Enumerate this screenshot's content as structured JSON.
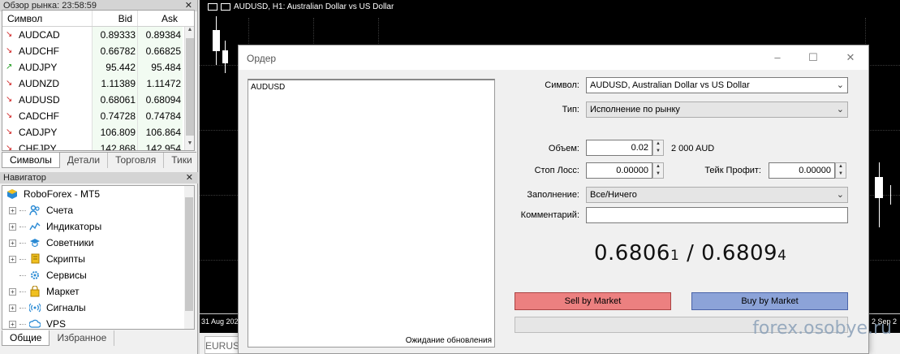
{
  "market_watch": {
    "title": "Обзор рынка: 23:58:59",
    "columns": [
      "Символ",
      "Bid",
      "Ask"
    ],
    "rows": [
      {
        "symbol": "AUDCAD",
        "dir": "down",
        "bid": "0.89333",
        "ask": "0.89384"
      },
      {
        "symbol": "AUDCHF",
        "dir": "down",
        "bid": "0.66782",
        "ask": "0.66825"
      },
      {
        "symbol": "AUDJPY",
        "dir": "up",
        "bid": "95.442",
        "ask": "95.484"
      },
      {
        "symbol": "AUDNZD",
        "dir": "down",
        "bid": "1.11389",
        "ask": "1.11472"
      },
      {
        "symbol": "AUDUSD",
        "dir": "down",
        "bid": "0.68061",
        "ask": "0.68094"
      },
      {
        "symbol": "CADCHF",
        "dir": "down",
        "bid": "0.74728",
        "ask": "0.74784"
      },
      {
        "symbol": "CADJPY",
        "dir": "down",
        "bid": "106.809",
        "ask": "106.864"
      },
      {
        "symbol": "CHFJPY",
        "dir": "down",
        "bid": "142.868",
        "ask": "142.954"
      }
    ],
    "tabs": [
      "Символы",
      "Детали",
      "Торговля",
      "Тики"
    ]
  },
  "navigator": {
    "title": "Навигатор",
    "root": "RoboForex - MT5",
    "items": [
      {
        "label": "Счета",
        "icon": "accounts-icon",
        "expandable": true
      },
      {
        "label": "Индикаторы",
        "icon": "indicators-icon",
        "expandable": true
      },
      {
        "label": "Советники",
        "icon": "experts-icon",
        "expandable": true
      },
      {
        "label": "Скрипты",
        "icon": "scripts-icon",
        "expandable": true
      },
      {
        "label": "Сервисы",
        "icon": "services-icon",
        "expandable": false
      },
      {
        "label": "Маркет",
        "icon": "market-icon",
        "expandable": true
      },
      {
        "label": "Сигналы",
        "icon": "signals-icon",
        "expandable": true
      },
      {
        "label": "VPS",
        "icon": "vps-icon",
        "expandable": true
      }
    ],
    "tabs": [
      "Общие",
      "Избранное"
    ]
  },
  "chart": {
    "title": "AUDUSD, H1:  Australian Dollar vs US Dollar",
    "x_left": "31 Aug 202",
    "x_right": "2 Sep 2",
    "tab": "EURUS"
  },
  "order": {
    "title": "Ордер",
    "tick_symbol": "AUDUSD",
    "waiting": "Ожидание обновления",
    "symbol_label": "Символ:",
    "symbol_value": "AUDUSD, Australian Dollar vs US Dollar",
    "type_label": "Тип:",
    "type_value": "Исполнение по рынку",
    "volume_label": "Объем:",
    "volume_value": "0.02",
    "volume_note": "2 000 AUD",
    "sl_label": "Стоп Лосс:",
    "sl_value": "0.00000",
    "tp_label": "Тейк Профит:",
    "tp_value": "0.00000",
    "fill_label": "Заполнение:",
    "fill_value": "Все/Ничего",
    "comment_label": "Комментарий:",
    "comment_value": "",
    "bid_main": "0.6806",
    "bid_last": "1",
    "sep": " / ",
    "ask_main": "0.6809",
    "ask_last": "4",
    "sell_label": "Sell by Market",
    "buy_label": "Buy by Market"
  },
  "watermark": "forex.osobye.ru",
  "colors": {
    "sell": "#ec8080",
    "buy": "#8ca3d8",
    "down_arrow": "#d02020",
    "up_arrow": "#1a9a1a"
  }
}
